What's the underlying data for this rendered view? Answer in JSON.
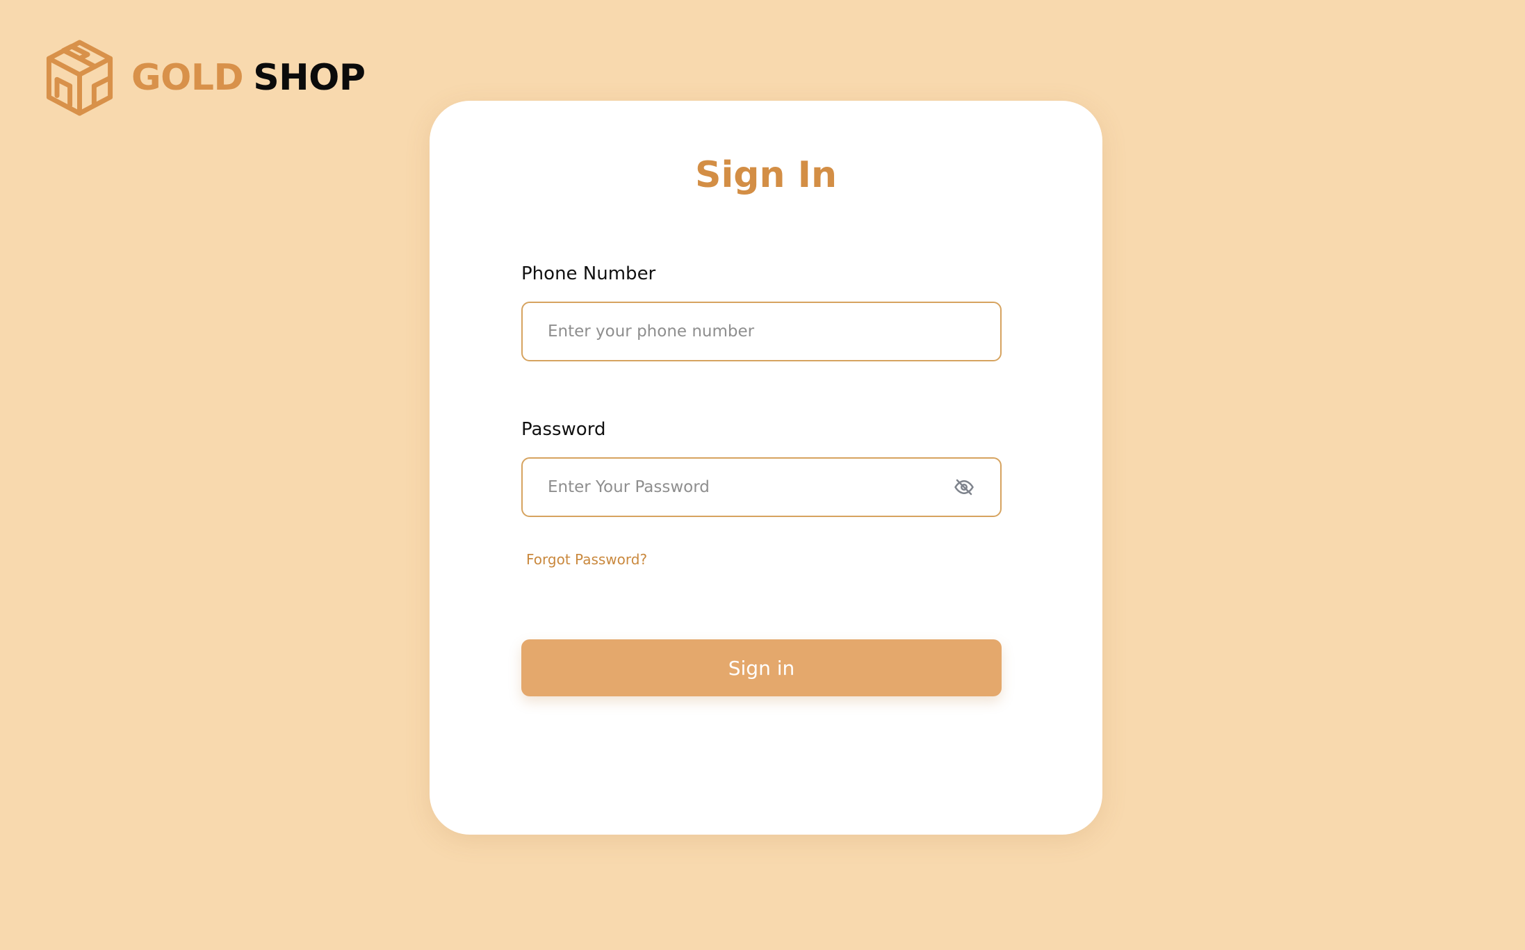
{
  "brand": {
    "name_part1": "GOLD",
    "name_part2": "SHOP",
    "logo_icon": "cube-box-icon",
    "accent_color": "#D8914A"
  },
  "form": {
    "title": "Sign In",
    "phone": {
      "label": "Phone Number",
      "placeholder": "Enter your phone number",
      "value": ""
    },
    "password": {
      "label": "Password",
      "placeholder": "Enter Your Password",
      "value": "",
      "toggle_icon": "eye-slash-icon"
    },
    "forgot_password_label": "Forgot Password?",
    "submit_label": "Sign in"
  },
  "colors": {
    "background": "#F8D9AE",
    "card": "#FFFFFF",
    "title": "#D38E45",
    "input_border": "#D6A35F",
    "button": "#E4A86C",
    "link": "#C9883D"
  }
}
